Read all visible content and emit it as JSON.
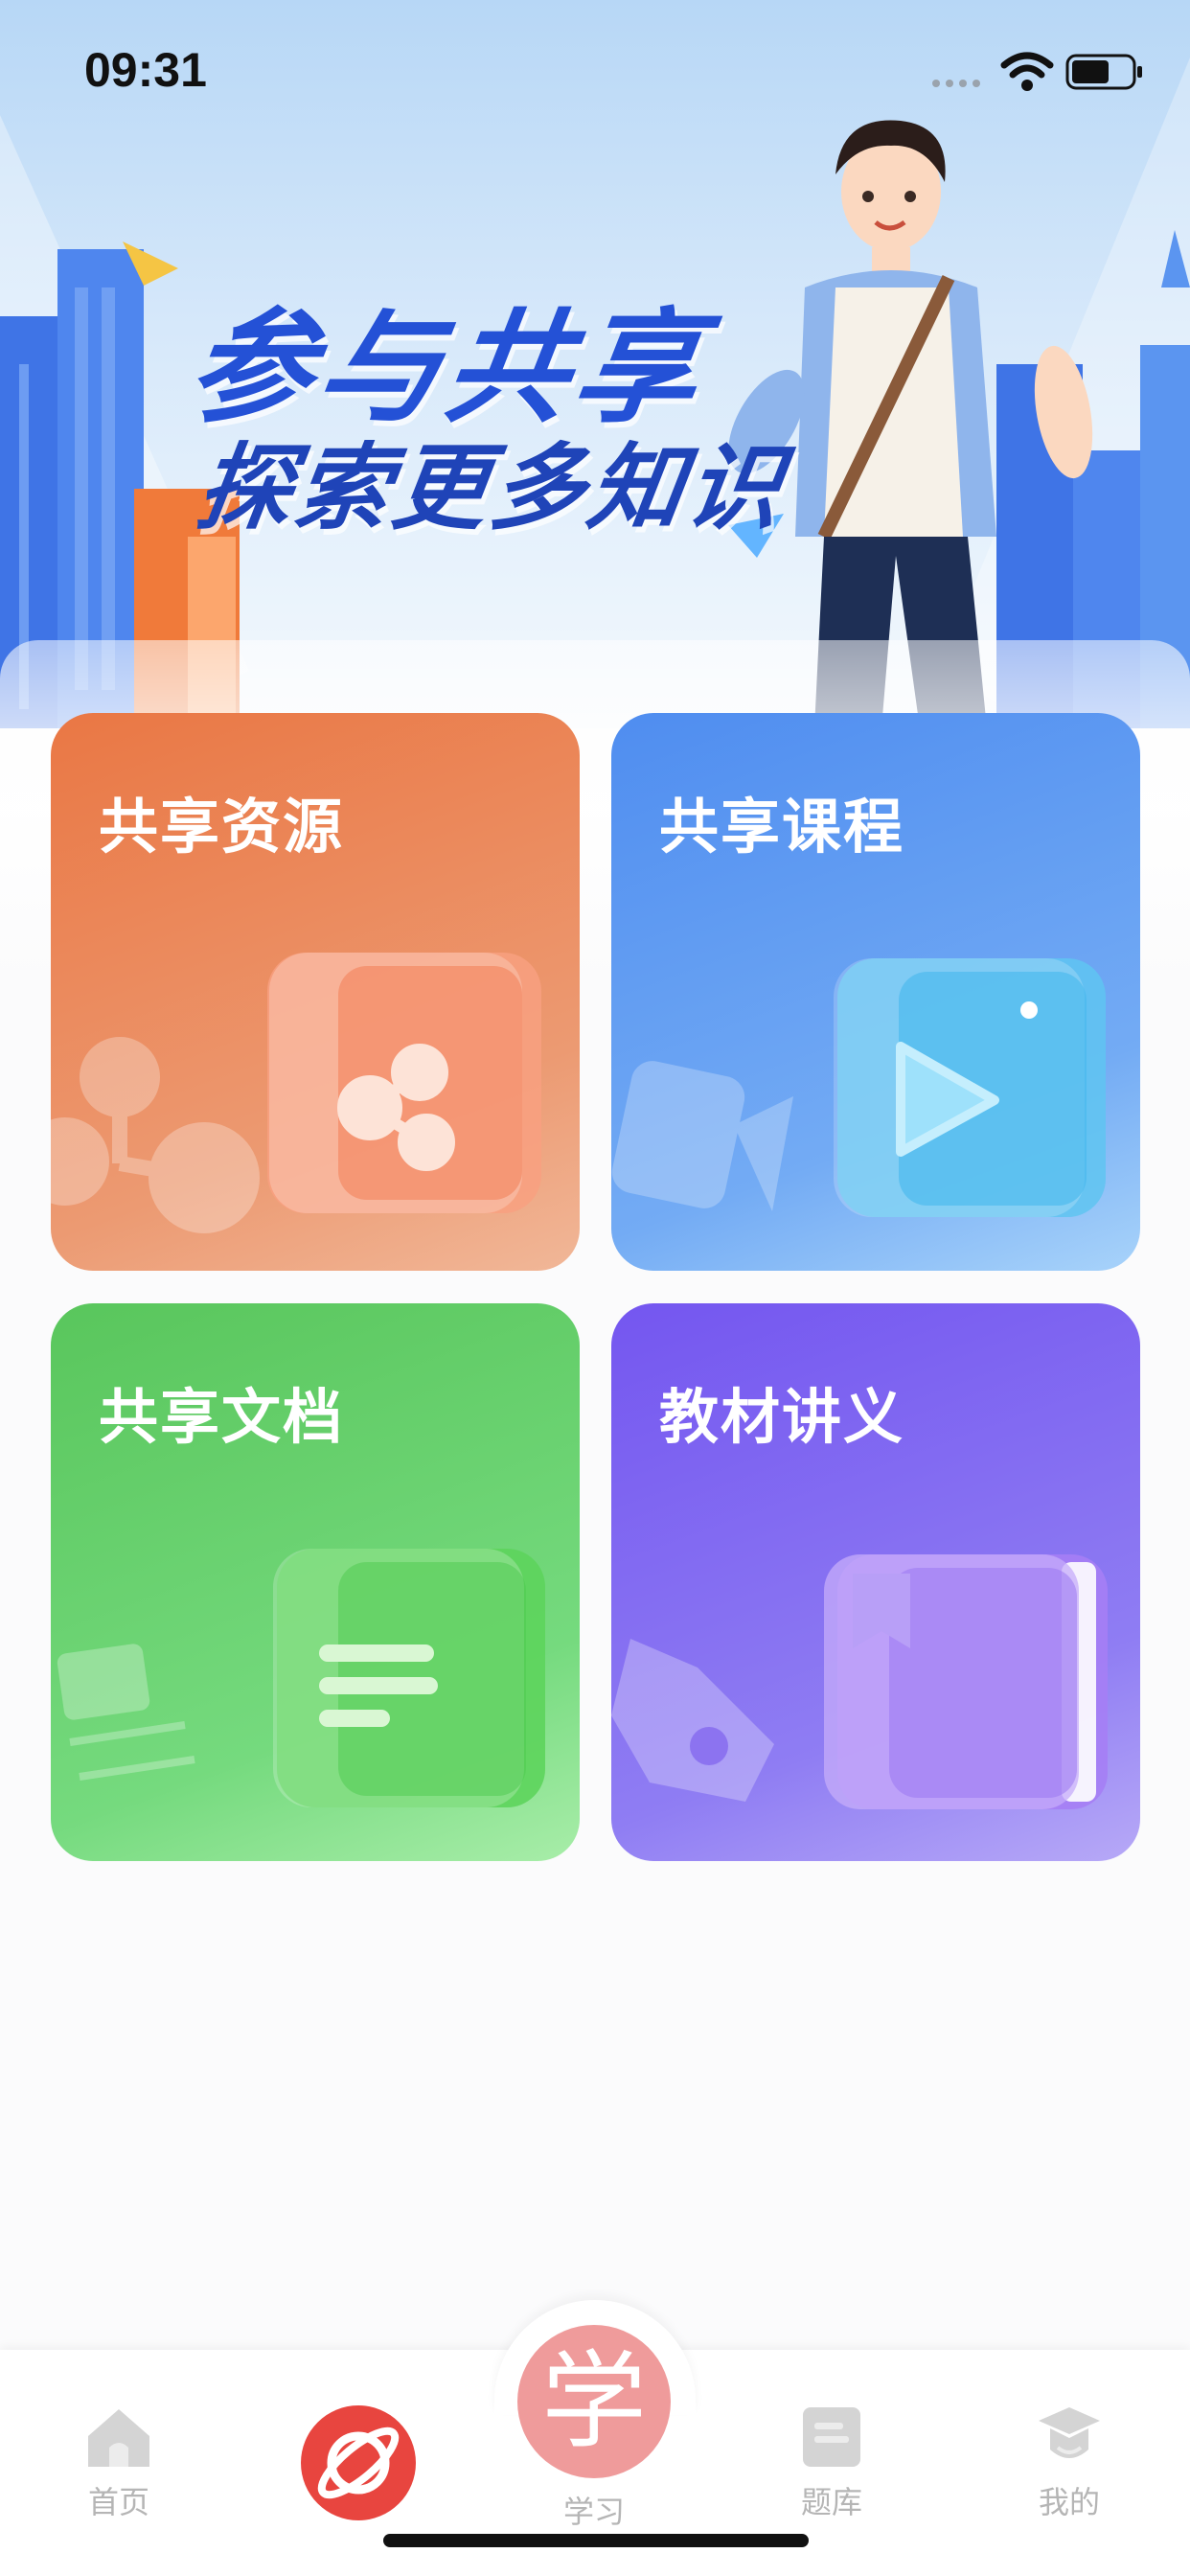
{
  "status_bar": {
    "time": "09:31"
  },
  "hero": {
    "title": "参与共享",
    "subtitle": "探索更多知识"
  },
  "cards": [
    {
      "label": "共享资源",
      "icon": "share-icon",
      "color": "#ea7744"
    },
    {
      "label": "共享课程",
      "icon": "play-icon",
      "color": "#4f8df0"
    },
    {
      "label": "共享文档",
      "icon": "document-icon",
      "color": "#59c65c"
    },
    {
      "label": "教材讲义",
      "icon": "book-icon",
      "color": "#7456f0"
    }
  ],
  "tab_bar": {
    "home": "首页",
    "learn_badge": "学",
    "learn": "学习",
    "questions": "题库",
    "mine": "我的",
    "accent_color": "#e8453f"
  }
}
